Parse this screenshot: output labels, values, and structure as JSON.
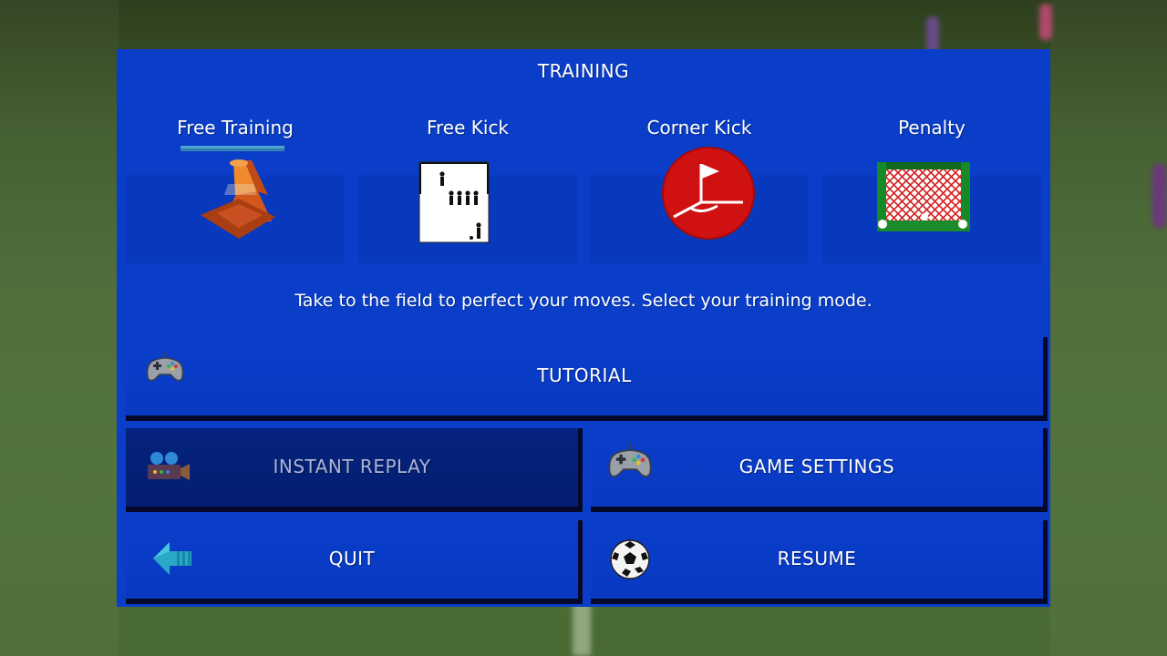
{
  "panel": {
    "title": "TRAINING",
    "description": "Take to the field to perfect your moves. Select your training mode."
  },
  "modes": [
    {
      "label": "Free Training",
      "icon": "traffic-cone-icon"
    },
    {
      "label": "Free Kick",
      "icon": "free-kick-wall-icon"
    },
    {
      "label": "Corner Kick",
      "icon": "corner-flag-icon"
    },
    {
      "label": "Penalty",
      "icon": "goal-net-icon"
    }
  ],
  "menu": {
    "tutorial": {
      "label": "TUTORIAL",
      "icon": "gamepad-icon"
    },
    "instant_replay": {
      "label": "INSTANT REPLAY",
      "icon": "video-camera-icon",
      "selected": true
    },
    "game_settings": {
      "label": "GAME SETTINGS",
      "icon": "gamepad-icon"
    },
    "quit": {
      "label": "QUIT",
      "icon": "back-arrow-icon"
    },
    "resume": {
      "label": "RESUME",
      "icon": "soccer-ball-icon"
    }
  },
  "colors": {
    "panel": "#0a3ec9",
    "tile": "#0839bd",
    "selected_button": "#05237f",
    "button_shadow": "#05082a"
  }
}
